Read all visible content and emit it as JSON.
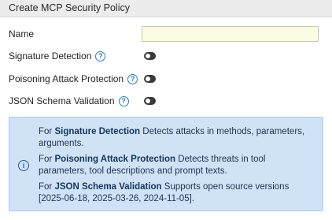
{
  "dialog": {
    "title": "Create MCP Security Policy"
  },
  "form": {
    "name_label": "Name",
    "name_value": "",
    "fields": [
      {
        "label": "Signature Detection",
        "enabled": false
      },
      {
        "label": "Poisoning Attack Protection",
        "enabled": false
      },
      {
        "label": "JSON Schema Validation",
        "enabled": false
      }
    ]
  },
  "info": {
    "icon": "info-circle-icon",
    "prefix": "For",
    "items": [
      {
        "term": "Signature Detection",
        "text": "Detects attacks in methods, parameters, arguments."
      },
      {
        "term": "Poisoning Attack Protection",
        "text": "Detects threats in tool parameters, tool descriptions and prompt texts."
      },
      {
        "term": "JSON Schema Validation",
        "text": "Supports open source versions [2025-06-18, 2025-03-26, 2024-11-05]."
      }
    ]
  },
  "colors": {
    "accent": "#2b7bc8",
    "info_background": "#cfe2f6",
    "input_background": "#fcfbe3"
  }
}
